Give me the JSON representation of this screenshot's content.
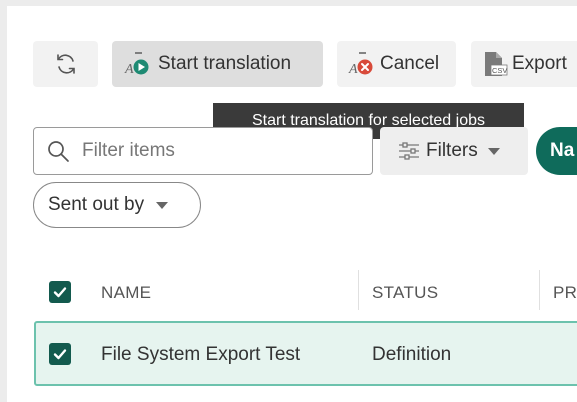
{
  "toolbar": {
    "start_translation_label": "Start translation",
    "cancel_label": "Cancel",
    "export_label": "Export",
    "export_icon_text": "CSV"
  },
  "tooltip": {
    "text": "Start translation for selected jobs"
  },
  "filter_bar": {
    "search_placeholder": "Filter items",
    "filters_label": "Filters",
    "chip_label": "Na",
    "sent_out_by_label": "Sent out by"
  },
  "table": {
    "columns": [
      "NAME",
      "STATUS",
      "PR"
    ],
    "header_checked": true,
    "rows": [
      {
        "checked": true,
        "name": "File System Export Test",
        "status": "Definition"
      }
    ]
  },
  "colors": {
    "accent": "#0f6b5b",
    "checkbox": "#135a4e",
    "selected_row_bg": "#e6f4ef",
    "selected_row_border": "#6cc2ad",
    "cancel_badge": "#d84a3a",
    "translate_badge": "#1e8a73",
    "tooltip_bg": "#3a3a3a"
  },
  "icons": {
    "refresh": "refresh-icon",
    "start_translation": "start-translation-icon",
    "cancel": "cancel-translation-icon",
    "export": "csv-export-icon",
    "search": "search-icon",
    "filters": "sliders-icon",
    "dropdown": "caret-down-icon",
    "check": "check-icon"
  }
}
